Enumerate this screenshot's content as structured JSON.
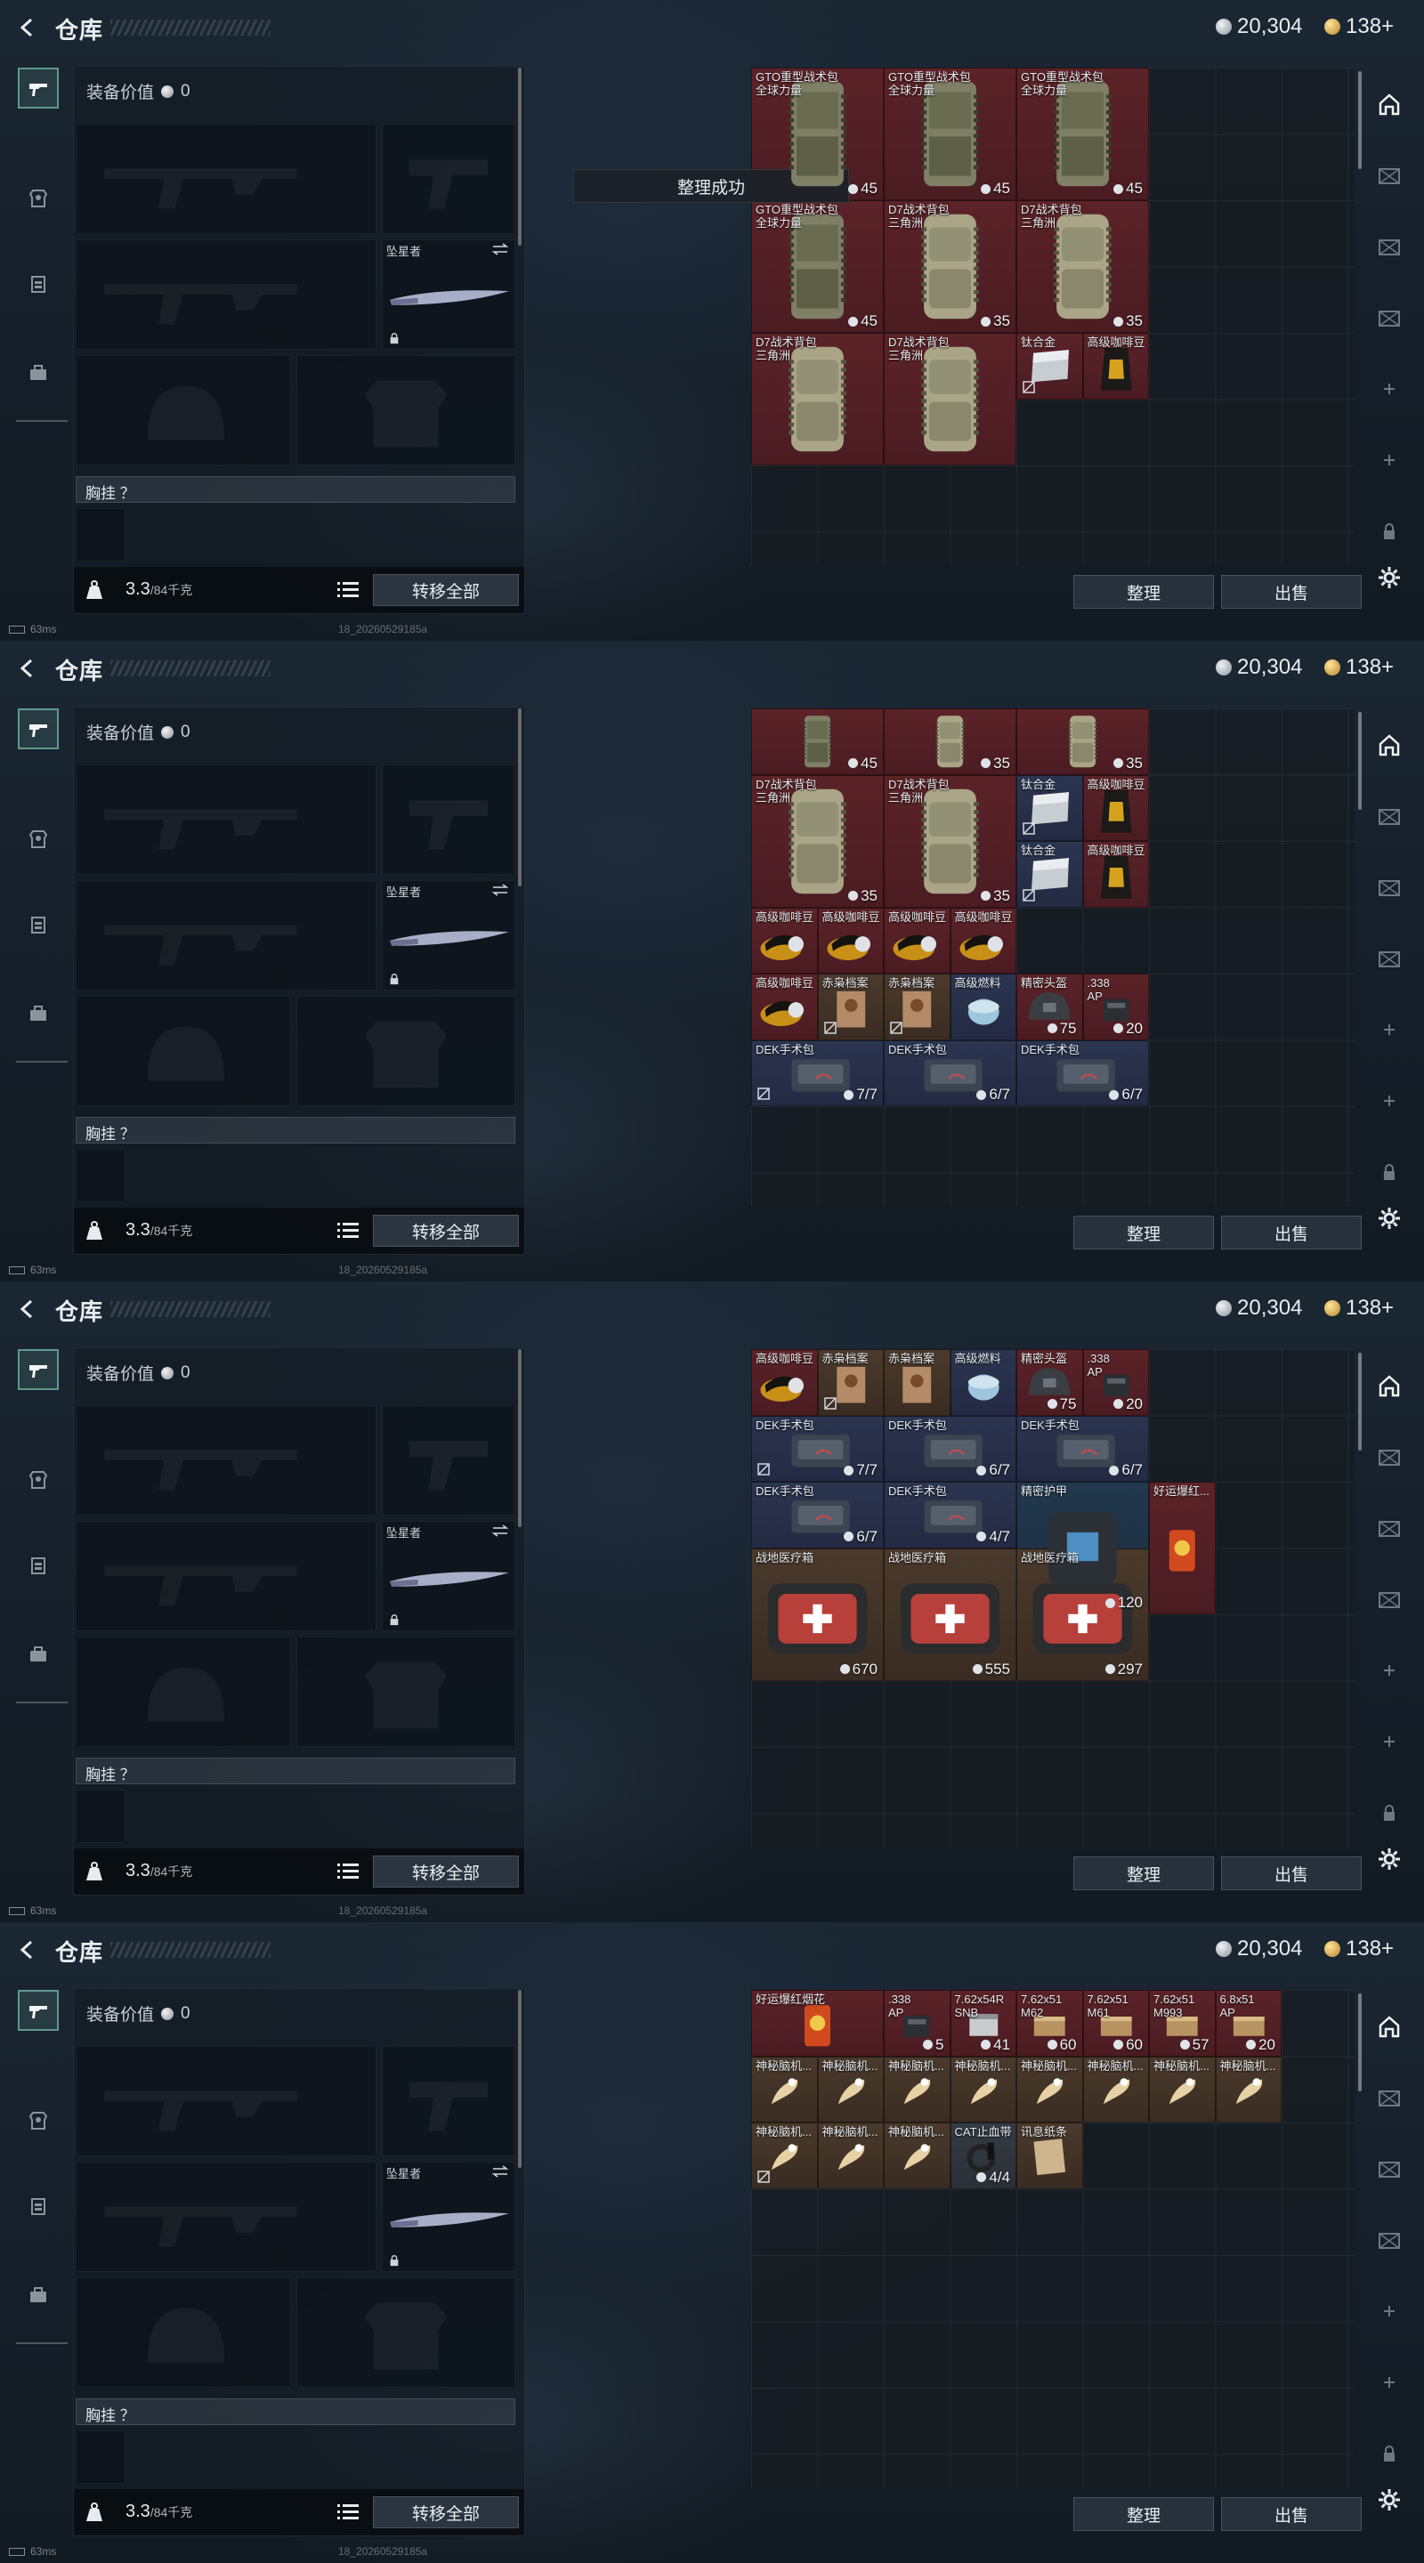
{
  "header": {
    "title": "仓库",
    "currency_silver": "20,304",
    "currency_gold": "138+"
  },
  "equipment": {
    "value_label": "装备价值",
    "value": "0",
    "melee_label": "坠星者",
    "chest_label": "胸挂 ？",
    "weight": "3.3",
    "weight_unit": "/84千克",
    "transfer_label": "转移全部"
  },
  "toast": "整理成功",
  "stash_buttons": {
    "sort": "整理",
    "sell": "出售"
  },
  "status": {
    "ping": "63ms",
    "build": "18_20260529185a"
  },
  "icons": {
    "back": "back-arrow-icon",
    "currency_silver": "silver-coin-icon",
    "currency_gold": "gold-coin-icon",
    "rail": [
      "gun-icon",
      "armor-icon",
      "vest-icon",
      "bag-icon"
    ],
    "rrail": [
      "home-icon",
      "crate-icon",
      "crate-icon",
      "crate-icon",
      "plus-icon",
      "plus-icon",
      "lock-icon",
      "gear-icon"
    ]
  },
  "colors": {
    "rarity_red": "#5b2328",
    "rarity_purple": "#2c3550",
    "rarity_blue": "#22384d",
    "rarity_brown": "#4a3a2c"
  },
  "screens": [
    {
      "items": [
        {
          "r": 0,
          "c": 0,
          "w": 2,
          "h": 2,
          "t": "red",
          "name": "GTO重型战术包\n全球力量",
          "count": "45",
          "icon": "backpack"
        },
        {
          "r": 0,
          "c": 2,
          "w": 2,
          "h": 2,
          "t": "red",
          "name": "GTO重型战术包\n全球力量",
          "count": "45",
          "icon": "backpack"
        },
        {
          "r": 0,
          "c": 4,
          "w": 2,
          "h": 2,
          "t": "red",
          "name": "GTO重型战术包\n全球力量",
          "count": "45",
          "icon": "backpack"
        },
        {
          "r": 2,
          "c": 0,
          "w": 2,
          "h": 2,
          "t": "red",
          "name": "GTO重型战术包\n全球力量",
          "count": "45",
          "icon": "backpack"
        },
        {
          "r": 2,
          "c": 2,
          "w": 2,
          "h": 2,
          "t": "red",
          "name": "D7战术背包\n三角洲",
          "count": "35",
          "icon": "backpack2"
        },
        {
          "r": 2,
          "c": 4,
          "w": 2,
          "h": 2,
          "t": "red",
          "name": "D7战术背包\n三角洲",
          "count": "35",
          "icon": "backpack2"
        },
        {
          "r": 4,
          "c": 0,
          "w": 2,
          "h": 2,
          "t": "red",
          "name": "D7战术背包\n三角洲",
          "count": "",
          "icon": "backpack2"
        },
        {
          "r": 4,
          "c": 2,
          "w": 2,
          "h": 2,
          "t": "red",
          "name": "D7战术背包\n三角洲",
          "count": "",
          "icon": "backpack2"
        },
        {
          "r": 4,
          "c": 4,
          "w": 1,
          "h": 1,
          "t": "red",
          "name": "钛合金",
          "count": "",
          "icon": "plate",
          "lock": true
        },
        {
          "r": 4,
          "c": 5,
          "w": 1,
          "h": 1,
          "t": "red",
          "name": "高级咖啡豆",
          "count": "",
          "icon": "coffee"
        }
      ]
    },
    {
      "items": [
        {
          "r": 0,
          "c": 0,
          "w": 2,
          "h": 1,
          "t": "red",
          "name": "",
          "count": "45",
          "icon": "backpack"
        },
        {
          "r": 0,
          "c": 2,
          "w": 2,
          "h": 1,
          "t": "red",
          "name": "",
          "count": "35",
          "icon": "backpack2"
        },
        {
          "r": 0,
          "c": 4,
          "w": 2,
          "h": 1,
          "t": "red",
          "name": "",
          "count": "35",
          "icon": "backpack2"
        },
        {
          "r": 1,
          "c": 0,
          "w": 2,
          "h": 2,
          "t": "red",
          "name": "D7战术背包\n三角洲",
          "count": "35",
          "icon": "backpack2"
        },
        {
          "r": 1,
          "c": 2,
          "w": 2,
          "h": 2,
          "t": "red",
          "name": "D7战术背包\n三角洲",
          "count": "35",
          "icon": "backpack2"
        },
        {
          "r": 1,
          "c": 4,
          "w": 1,
          "h": 1,
          "t": "purple",
          "name": "钛合金",
          "count": "",
          "icon": "plate",
          "lock": true
        },
        {
          "r": 1,
          "c": 5,
          "w": 1,
          "h": 1,
          "t": "red",
          "name": "高级咖啡豆",
          "count": "",
          "icon": "coffee"
        },
        {
          "r": 2,
          "c": 4,
          "w": 1,
          "h": 1,
          "t": "purple",
          "name": "钛合金",
          "count": "",
          "icon": "plate",
          "lock": true
        },
        {
          "r": 2,
          "c": 5,
          "w": 1,
          "h": 1,
          "t": "red",
          "name": "高级咖啡豆",
          "count": "",
          "icon": "coffee"
        },
        {
          "r": 3,
          "c": 0,
          "w": 1,
          "h": 1,
          "t": "red",
          "name": "高级咖啡豆",
          "count": "",
          "icon": "coffee2"
        },
        {
          "r": 3,
          "c": 1,
          "w": 1,
          "h": 1,
          "t": "red",
          "name": "高级咖啡豆",
          "count": "",
          "icon": "coffee2"
        },
        {
          "r": 3,
          "c": 2,
          "w": 1,
          "h": 1,
          "t": "red",
          "name": "高级咖啡豆",
          "count": "",
          "icon": "coffee2"
        },
        {
          "r": 3,
          "c": 3,
          "w": 1,
          "h": 1,
          "t": "red",
          "name": "高级咖啡豆",
          "count": "",
          "icon": "coffee2"
        },
        {
          "r": 4,
          "c": 0,
          "w": 1,
          "h": 1,
          "t": "red",
          "name": "高级咖啡豆",
          "count": "",
          "icon": "coffee2"
        },
        {
          "r": 4,
          "c": 1,
          "w": 1,
          "h": 1,
          "t": "brown",
          "name": "赤枭档案",
          "count": "",
          "icon": "doc",
          "lock": true
        },
        {
          "r": 4,
          "c": 2,
          "w": 1,
          "h": 1,
          "t": "brown",
          "name": "赤枭档案",
          "count": "",
          "icon": "doc",
          "lock": true
        },
        {
          "r": 4,
          "c": 3,
          "w": 1,
          "h": 1,
          "t": "purple",
          "name": "高级燃料",
          "count": "",
          "icon": "fuel"
        },
        {
          "r": 4,
          "c": 4,
          "w": 1,
          "h": 1,
          "t": "red",
          "name": "精密头盔",
          "count": "75",
          "icon": "helmet"
        },
        {
          "r": 4,
          "c": 5,
          "w": 1,
          "h": 1,
          "t": "red",
          "name": ".338\nAP",
          "count": "20",
          "icon": "ammo"
        },
        {
          "r": 5,
          "c": 0,
          "w": 2,
          "h": 1,
          "t": "purple",
          "name": "DEK手术包",
          "count": "7/7",
          "icon": "kit",
          "lock": true
        },
        {
          "r": 5,
          "c": 2,
          "w": 2,
          "h": 1,
          "t": "purple",
          "name": "DEK手术包",
          "count": "6/7",
          "icon": "kit"
        },
        {
          "r": 5,
          "c": 4,
          "w": 2,
          "h": 1,
          "t": "purple",
          "name": "DEK手术包",
          "count": "6/7",
          "icon": "kit"
        }
      ]
    },
    {
      "items": [
        {
          "r": 0,
          "c": 0,
          "w": 1,
          "h": 1,
          "t": "red",
          "name": "高级咖啡豆",
          "count": "",
          "icon": "coffee2"
        },
        {
          "r": 0,
          "c": 1,
          "w": 1,
          "h": 1,
          "t": "brown",
          "name": "赤枭档案",
          "count": "",
          "icon": "doc",
          "lock": true
        },
        {
          "r": 0,
          "c": 2,
          "w": 1,
          "h": 1,
          "t": "brown",
          "name": "赤枭档案",
          "count": "",
          "icon": "doc"
        },
        {
          "r": 0,
          "c": 3,
          "w": 1,
          "h": 1,
          "t": "purple",
          "name": "高级燃料",
          "count": "",
          "icon": "fuel"
        },
        {
          "r": 0,
          "c": 4,
          "w": 1,
          "h": 1,
          "t": "red",
          "name": "精密头盔",
          "count": "75",
          "icon": "helmet"
        },
        {
          "r": 0,
          "c": 5,
          "w": 1,
          "h": 1,
          "t": "red",
          "name": ".338\nAP",
          "count": "20",
          "icon": "ammo"
        },
        {
          "r": 1,
          "c": 0,
          "w": 2,
          "h": 1,
          "t": "purple",
          "name": "DEK手术包",
          "count": "7/7",
          "icon": "kit",
          "lock": true
        },
        {
          "r": 1,
          "c": 2,
          "w": 2,
          "h": 1,
          "t": "purple",
          "name": "DEK手术包",
          "count": "6/7",
          "icon": "kit"
        },
        {
          "r": 1,
          "c": 4,
          "w": 2,
          "h": 1,
          "t": "purple",
          "name": "DEK手术包",
          "count": "6/7",
          "icon": "kit"
        },
        {
          "r": 2,
          "c": 0,
          "w": 2,
          "h": 1,
          "t": "purple",
          "name": "DEK手术包",
          "count": "6/7",
          "icon": "kit"
        },
        {
          "r": 2,
          "c": 2,
          "w": 2,
          "h": 1,
          "t": "purple",
          "name": "DEK手术包",
          "count": "4/7",
          "icon": "kit"
        },
        {
          "r": 2,
          "c": 4,
          "w": 2,
          "h": 2,
          "t": "blue",
          "name": "精密护甲",
          "count": "120",
          "icon": "armor"
        },
        {
          "r": 2,
          "c": 6,
          "w": 1,
          "h": 2,
          "t": "red",
          "name": "好运爆红...",
          "count": "",
          "icon": "firework"
        },
        {
          "r": 3,
          "c": 0,
          "w": 2,
          "h": 2,
          "t": "brown",
          "name": "战地医疗箱",
          "count": "670",
          "icon": "medbox"
        },
        {
          "r": 3,
          "c": 2,
          "w": 2,
          "h": 2,
          "t": "brown",
          "name": "战地医疗箱",
          "count": "555",
          "icon": "medbox"
        },
        {
          "r": 3,
          "c": 4,
          "w": 2,
          "h": 2,
          "t": "brown",
          "name": "战地医疗箱",
          "count": "297",
          "icon": "medbox"
        }
      ]
    },
    {
      "items": [
        {
          "r": 0,
          "c": 0,
          "w": 2,
          "h": 1,
          "t": "red",
          "name": "好运爆红烟花",
          "count": "",
          "icon": "firework"
        },
        {
          "r": 0,
          "c": 2,
          "w": 1,
          "h": 1,
          "t": "red",
          "name": ".338\nAP",
          "count": "5",
          "icon": "ammo"
        },
        {
          "r": 0,
          "c": 3,
          "w": 1,
          "h": 1,
          "t": "red",
          "name": "7.62x54R\nSNB",
          "count": "41",
          "icon": "ammo2"
        },
        {
          "r": 0,
          "c": 4,
          "w": 1,
          "h": 1,
          "t": "red",
          "name": "7.62x51\nM62",
          "count": "60",
          "icon": "ammo3"
        },
        {
          "r": 0,
          "c": 5,
          "w": 1,
          "h": 1,
          "t": "red",
          "name": "7.62x51\nM61",
          "count": "60",
          "icon": "ammo3"
        },
        {
          "r": 0,
          "c": 6,
          "w": 1,
          "h": 1,
          "t": "red",
          "name": "7.62x51\nM993",
          "count": "57",
          "icon": "ammo3"
        },
        {
          "r": 0,
          "c": 7,
          "w": 1,
          "h": 1,
          "t": "red",
          "name": "6.8x51\nAP",
          "count": "20",
          "icon": "ammo3"
        },
        {
          "r": 1,
          "c": 0,
          "w": 1,
          "h": 1,
          "t": "brown",
          "name": "神秘脑机...",
          "count": "",
          "icon": "brain"
        },
        {
          "r": 1,
          "c": 1,
          "w": 1,
          "h": 1,
          "t": "brown",
          "name": "神秘脑机...",
          "count": "",
          "icon": "brain"
        },
        {
          "r": 1,
          "c": 2,
          "w": 1,
          "h": 1,
          "t": "brown",
          "name": "神秘脑机...",
          "count": "",
          "icon": "brain"
        },
        {
          "r": 1,
          "c": 3,
          "w": 1,
          "h": 1,
          "t": "brown",
          "name": "神秘脑机...",
          "count": "",
          "icon": "brain"
        },
        {
          "r": 1,
          "c": 4,
          "w": 1,
          "h": 1,
          "t": "brown",
          "name": "神秘脑机...",
          "count": "",
          "icon": "brain"
        },
        {
          "r": 1,
          "c": 5,
          "w": 1,
          "h": 1,
          "t": "brown",
          "name": "神秘脑机...",
          "count": "",
          "icon": "brain"
        },
        {
          "r": 1,
          "c": 6,
          "w": 1,
          "h": 1,
          "t": "brown",
          "name": "神秘脑机...",
          "count": "",
          "icon": "brain"
        },
        {
          "r": 1,
          "c": 7,
          "w": 1,
          "h": 1,
          "t": "brown",
          "name": "神秘脑机...",
          "count": "",
          "icon": "brain"
        },
        {
          "r": 2,
          "c": 0,
          "w": 1,
          "h": 1,
          "t": "brown",
          "name": "神秘脑机...",
          "count": "",
          "icon": "brain",
          "lock": true
        },
        {
          "r": 2,
          "c": 1,
          "w": 1,
          "h": 1,
          "t": "brown",
          "name": "神秘脑机...",
          "count": "",
          "icon": "brain"
        },
        {
          "r": 2,
          "c": 2,
          "w": 1,
          "h": 1,
          "t": "brown",
          "name": "神秘脑机...",
          "count": "",
          "icon": "brain"
        },
        {
          "r": 2,
          "c": 3,
          "w": 1,
          "h": 1,
          "t": "gray",
          "name": "CAT止血带",
          "count": "4/4",
          "icon": "tourniquet"
        },
        {
          "r": 2,
          "c": 4,
          "w": 1,
          "h": 1,
          "t": "brown",
          "name": "讯息纸条",
          "count": "",
          "icon": "note"
        }
      ]
    }
  ]
}
